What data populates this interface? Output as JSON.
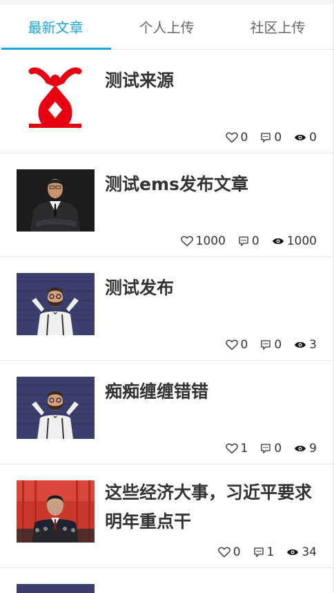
{
  "tabs": [
    {
      "label": "最新文章",
      "active": true
    },
    {
      "label": "个人上传",
      "active": false
    },
    {
      "label": "社区上传",
      "active": false
    }
  ],
  "articles": [
    {
      "title": "测试来源",
      "likes": "0",
      "comments": "0",
      "views": "0",
      "thumb": "logo"
    },
    {
      "title": "测试ems发布文章",
      "likes": "1000",
      "comments": "0",
      "views": "1000",
      "thumb": "businessman"
    },
    {
      "title": "测试发布",
      "likes": "0",
      "comments": "0",
      "views": "3",
      "thumb": "bearded-man"
    },
    {
      "title": "痴痴缠缠错错",
      "likes": "1",
      "comments": "0",
      "views": "9",
      "thumb": "bearded-man"
    },
    {
      "title": "这些经济大事，习近平要求明年重点干",
      "likes": "0",
      "comments": "1",
      "views": "34",
      "thumb": "speaker"
    }
  ],
  "colors": {
    "accent": "#1aa7e0",
    "logo_red": "#e60012"
  }
}
